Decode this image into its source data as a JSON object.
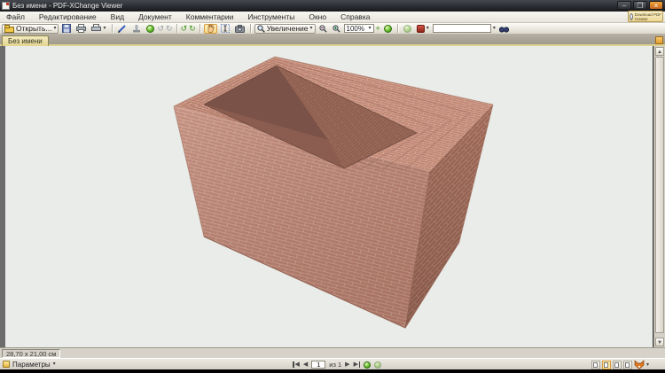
{
  "window": {
    "title": "Без имени - PDF-XChange Viewer",
    "controls": {
      "minimize": "–",
      "maximize": "❐",
      "close": "×"
    }
  },
  "promo": {
    "line1": "Download PDF",
    "line2": "Creator"
  },
  "menu": {
    "items": [
      "Файл",
      "Редактирование",
      "Вид",
      "Документ",
      "Комментарии",
      "Инструменты",
      "Окно",
      "Справка"
    ]
  },
  "toolbar": {
    "open_label": "Открыть...",
    "zoom_tool_label": "Увеличение",
    "zoom_level": "100%",
    "search_value": ""
  },
  "tabbar": {
    "active_tab_label": "Без имени"
  },
  "statusbar": {
    "page_size": "28,70 x 21,00 см",
    "options_label": "Параметры",
    "page_current": "1",
    "page_of_label": "из 1"
  },
  "icons": {
    "caret_down": "▾",
    "nav_prev": "◀",
    "nav_next": "▶",
    "undo": "↺",
    "redo": "↻",
    "rotate_left": "↺",
    "rotate_right": "↻",
    "plus": "+",
    "minus": "−"
  },
  "scene": {
    "description": "3D render of an open-top rectangular brick box on a light page",
    "colors": {
      "brick_front": "#bc8170",
      "brick_right": "#a56d5c",
      "brick_top": "#c18876",
      "inner_shadow": "#7a5247",
      "page_bg": "#e9ece8"
    }
  }
}
